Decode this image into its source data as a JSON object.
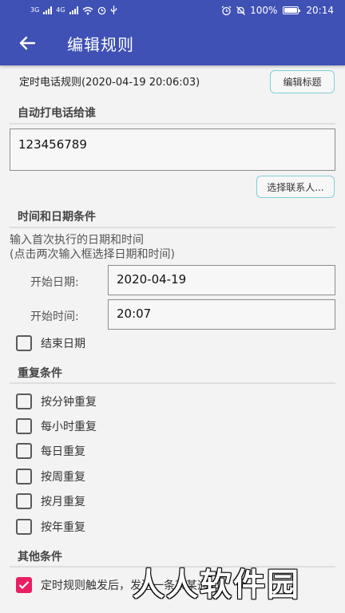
{
  "status_bar": {
    "net_left": "3G",
    "net_right": "4G",
    "battery": "100%",
    "time": "20:14"
  },
  "app_bar": {
    "title": "编辑规则"
  },
  "rule": {
    "name": "定时电话规则(2020-04-19 20:06:03)",
    "edit_title_button": "编辑标题"
  },
  "call_section": {
    "title": "自动打电话给谁",
    "phone_value": "123456789",
    "select_contact_button": "选择联系人..."
  },
  "time_section": {
    "title": "时间和日期条件",
    "hint_line1": "输入首次执行的日期和时间",
    "hint_line2": "(点击两次输入框选择日期和时间)",
    "start_date_label": "开始日期:",
    "start_date_value": "2020-04-19",
    "start_time_label": "开始时间:",
    "start_time_value": "20:07",
    "end_date_label": "结束日期"
  },
  "repeat_section": {
    "title": "重复条件",
    "options": [
      {
        "label": "按分钟重复",
        "checked": false
      },
      {
        "label": "每小时重复",
        "checked": false
      },
      {
        "label": "每日重复",
        "checked": false
      },
      {
        "label": "按周重复",
        "checked": false
      },
      {
        "label": "按月重复",
        "checked": false
      },
      {
        "label": "按年重复",
        "checked": false
      }
    ]
  },
  "other_section": {
    "title": "其他条件",
    "option_label": "定时规则触发后，发送一条某某通知",
    "option_checked": true
  },
  "watermark": "人人软件园",
  "colors": {
    "primary": "#3f51b5",
    "accent": "#e91e63",
    "button_border": "#7fcfd6"
  }
}
